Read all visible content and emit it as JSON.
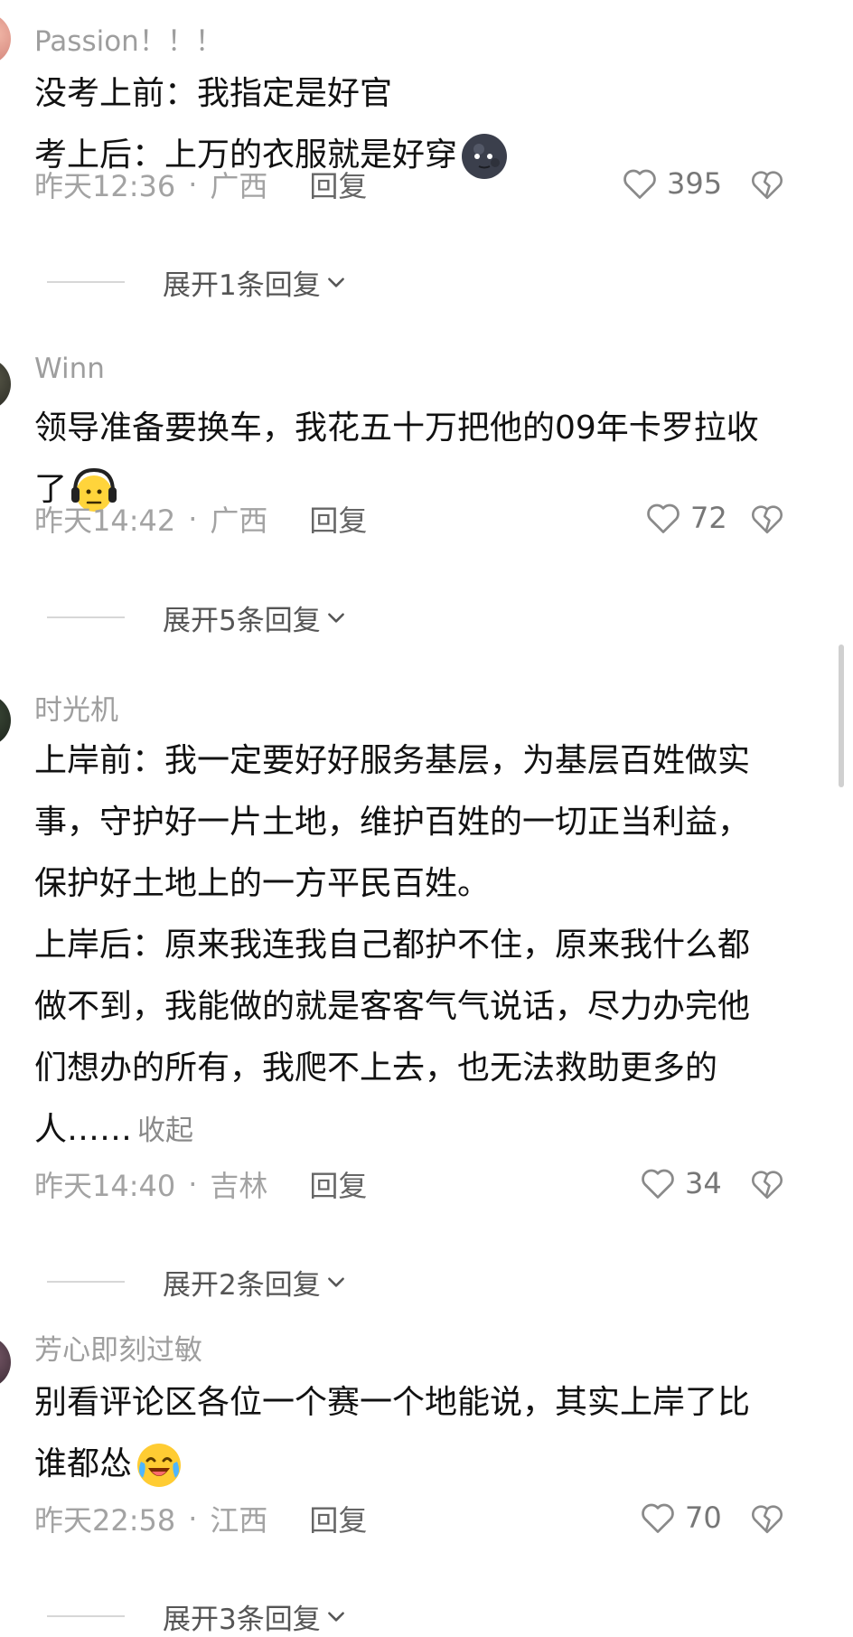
{
  "comments": [
    {
      "username": "Passion！！！",
      "lines": [
        "没考上前：我指定是好官",
        "考上后：上万的衣服就是好穿"
      ],
      "emoji": "dark-moon-face-emoji",
      "time": "昨天12:36",
      "separator": "·",
      "location": "广西",
      "reply_label": "回复",
      "likes": "395",
      "expand_label": "展开1条回复"
    },
    {
      "username": "Winn",
      "lines": [
        "领导准备要换车，我花五十万把他的09年卡罗拉收",
        "了"
      ],
      "emoji": "headphone-face-emoji",
      "time": "昨天14:42",
      "separator": "·",
      "location": "广西",
      "reply_label": "回复",
      "likes": "72",
      "expand_label": "展开5条回复"
    },
    {
      "username": "时光机",
      "lines": [
        "上岸前：我一定要好好服务基层，为基层百姓做实",
        "事，守护好一片土地，维护百姓的一切正当利益，",
        "保护好土地上的一方平民百姓。",
        "上岸后：原来我连我自己都护不住，原来我什么都",
        "做不到，我能做的就是客客气气说话，尽力办完他",
        "们想办的所有，我爬不上去，也无法救助更多的",
        "人……"
      ],
      "collapse_label": "收起",
      "time": "昨天14:40",
      "separator": "·",
      "location": "吉林",
      "reply_label": "回复",
      "likes": "34",
      "expand_label": "展开2条回复"
    },
    {
      "username": "芳心即刻过敏",
      "lines": [
        "别看评论区各位一个赛一个地能说，其实上岸了比",
        "谁都怂"
      ],
      "emoji": "crying-laughing-face-emoji",
      "time": "昨天22:58",
      "separator": "·",
      "location": "江西",
      "reply_label": "回复",
      "likes": "70",
      "expand_label": "展开3条回复"
    }
  ],
  "colors": {
    "username": "#9e9e9e",
    "text": "#111111",
    "meta": "#a3a3a3",
    "reply": "#666666",
    "expand": "#555555"
  },
  "icons": [
    "heart-outline-icon",
    "broken-heart-icon",
    "chevron-down-icon"
  ]
}
